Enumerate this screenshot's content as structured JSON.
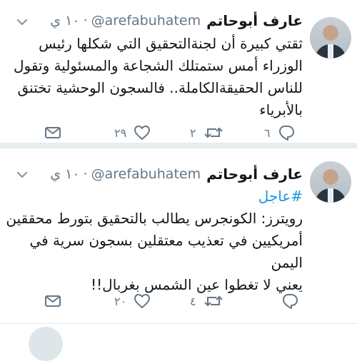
{
  "tweets": [
    {
      "author": "عارف أبوحاتم",
      "handle": "@arefabuhatem",
      "dot": "·",
      "time": "١٠ ي",
      "hashtag": "",
      "lines": [
        "ثقتي كبيرة أن لجنةالتحقيق التي شكلها رئيس",
        "الوزراء أمس ستمتلك الشجاعة والمسئولية وتقول",
        "للناس الحقيقةالكاملة.. فالسجون الوحشية تختنق",
        "بالأبرياء"
      ],
      "replies": "٦",
      "retweets": "٢",
      "likes": "٢٩",
      "icons": [
        "avatar",
        "chevron-down-icon",
        "reply-icon",
        "retweet-icon",
        "heart-icon",
        "mail-icon"
      ]
    },
    {
      "author": "عارف أبوحاتم",
      "handle": "@arefabuhatem",
      "dot": "·",
      "time": "١٠ ي",
      "hashtag": "#عاجل",
      "lines": [
        "رويترز: الكونجرس يطالب بالتحقيق بتورط محققين",
        "أمريكيين في تعذيب معتقلين بسجون سرية في",
        "اليمن",
        "يعني لا تغطوا عين الشمس بغربال!!"
      ],
      "replies": "",
      "retweets": "٤",
      "likes": "٢٠",
      "icons": [
        "avatar",
        "chevron-down-icon",
        "reply-icon",
        "retweet-icon",
        "heart-icon",
        "mail-icon"
      ]
    }
  ],
  "colors": {
    "text": "#14171a",
    "muted": "#657786",
    "link": "#1b95e0",
    "separator": "#e6ecf0"
  }
}
